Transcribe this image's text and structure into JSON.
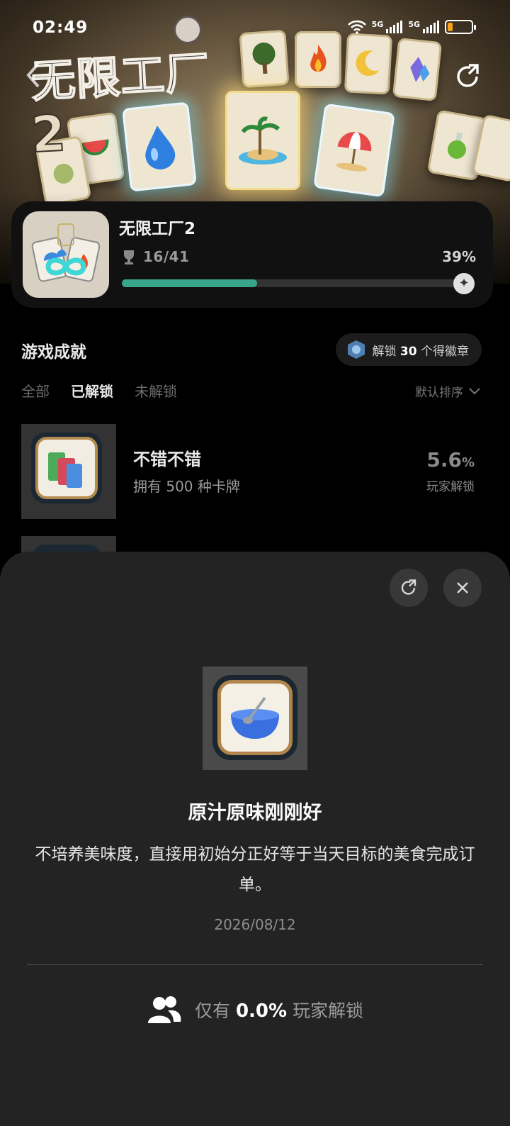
{
  "status_bar": {
    "time": "02:49",
    "signal_1": "5G",
    "signal_2": "5G",
    "battery_level": 0.15,
    "battery_color": "#f7a21c"
  },
  "hero": {
    "logo_text": "无限工厂",
    "logo_number": "2",
    "back_icon": "chevron-left-icon",
    "share_icon": "share-icon"
  },
  "summary": {
    "title": "无限工厂2",
    "unlocked_count": "16/41",
    "percent_label": "39%",
    "progress": 0.39,
    "accent_color": "#3aa48c"
  },
  "achievements": {
    "section_title": "游戏成就",
    "badge_pill": {
      "prefix": "解锁",
      "number": "30",
      "suffix": "个得徽章"
    },
    "tabs": [
      {
        "label": "全部",
        "active": false
      },
      {
        "label": "已解锁",
        "active": true
      },
      {
        "label": "未解锁",
        "active": false
      }
    ],
    "sort_label": "默认排序",
    "items": [
      {
        "name": "不错不错",
        "desc": "拥有 500 种卡牌",
        "rate_value": "5.6",
        "rate_unit": "%",
        "rate_label": "玩家解锁"
      }
    ]
  },
  "sheet": {
    "title": "原汁原味刚刚好",
    "description": "不培养美味度，直接用初始分正好等于当天目标的美食完成订单。",
    "date": "2026/08/12",
    "rarity": {
      "prefix": "仅有",
      "value": "0.0%",
      "suffix": "玩家解锁"
    },
    "close_icon": "close-icon",
    "share_icon": "share-icon"
  }
}
